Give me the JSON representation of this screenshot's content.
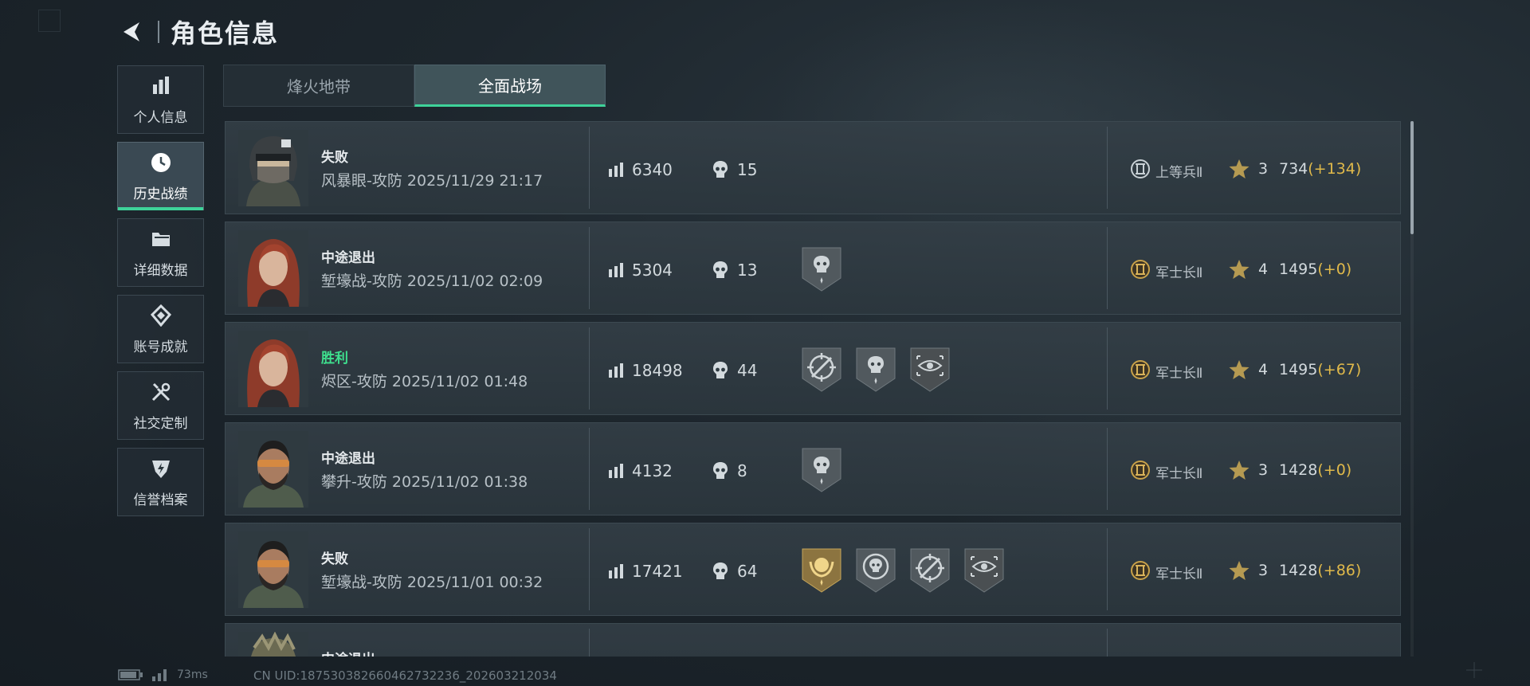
{
  "header": {
    "title": "角色信息",
    "back_icon": "back-arrow-icon"
  },
  "sidebar": {
    "items": [
      {
        "label": "个人信息",
        "icon": "bar-chart-icon",
        "active": false
      },
      {
        "label": "历史战绩",
        "icon": "clock-icon",
        "active": true
      },
      {
        "label": "详细数据",
        "icon": "folder-icon",
        "active": false
      },
      {
        "label": "账号成就",
        "icon": "achievement-icon",
        "active": false
      },
      {
        "label": "社交定制",
        "icon": "tools-icon",
        "active": false
      },
      {
        "label": "信誉档案",
        "icon": "shield-badge-icon",
        "active": false
      }
    ]
  },
  "tabs": [
    {
      "label": "烽火地带",
      "active": false
    },
    {
      "label": "全面战场",
      "active": true
    }
  ],
  "matches": [
    {
      "result": "失败",
      "win": false,
      "detail": "风暴眼-攻防 2025/11/29 21:17",
      "score": "6340",
      "kills": "15",
      "medals": [],
      "rank": "上等兵Ⅱ",
      "rank_tier": "silver",
      "stars": "3",
      "points": "734",
      "delta": "(+134)",
      "avatar": "helmet-soldier"
    },
    {
      "result": "中途退出",
      "win": false,
      "detail": "堑壕战-攻防 2025/11/02 02:09",
      "score": "5304",
      "kills": "13",
      "medals": [
        "skull-shield"
      ],
      "rank": "军士长Ⅱ",
      "rank_tier": "gold",
      "stars": "4",
      "points": "1495",
      "delta": "(+0)",
      "avatar": "red-hair"
    },
    {
      "result": "胜利",
      "win": true,
      "detail": "烬区-攻防 2025/11/02 01:48",
      "score": "18498",
      "kills": "44",
      "medals": [
        "crosshair-rifle",
        "skull-shield",
        "eye-target"
      ],
      "rank": "军士长Ⅱ",
      "rank_tier": "gold",
      "stars": "4",
      "points": "1495",
      "delta": "(+67)",
      "avatar": "red-hair"
    },
    {
      "result": "中途退出",
      "win": false,
      "detail": "攀升-攻防 2025/11/02 01:38",
      "score": "4132",
      "kills": "8",
      "medals": [
        "skull-shield"
      ],
      "rank": "军士长Ⅱ",
      "rank_tier": "gold",
      "stars": "3",
      "points": "1428",
      "delta": "(+0)",
      "avatar": "bearded-goggles"
    },
    {
      "result": "失败",
      "win": false,
      "detail": "堑壕战-攻防 2025/11/01 00:32",
      "score": "17421",
      "kills": "64",
      "medals": [
        "gold-laurel",
        "skull-circle",
        "crosshair-rifle",
        "eye-target"
      ],
      "rank": "军士长Ⅱ",
      "rank_tier": "gold",
      "stars": "3",
      "points": "1428",
      "delta": "(+86)",
      "avatar": "bearded-goggles"
    },
    {
      "result": "中途退出",
      "win": false,
      "detail": "",
      "score": "",
      "kills": "",
      "medals": [],
      "rank": "",
      "rank_tier": "gold",
      "stars": "",
      "points": "",
      "delta": "",
      "avatar": "armored-soldier"
    }
  ],
  "footer": {
    "ping": "73ms",
    "uid": "CN UID:18753038266046273223​6_202603212034",
    "battery_icon": "battery-icon",
    "signal_icon": "signal-icon"
  },
  "colors": {
    "accent": "#3ed39a",
    "win": "#3ee08e",
    "delta": "#e0b94a",
    "gold": "#c9a24a"
  }
}
